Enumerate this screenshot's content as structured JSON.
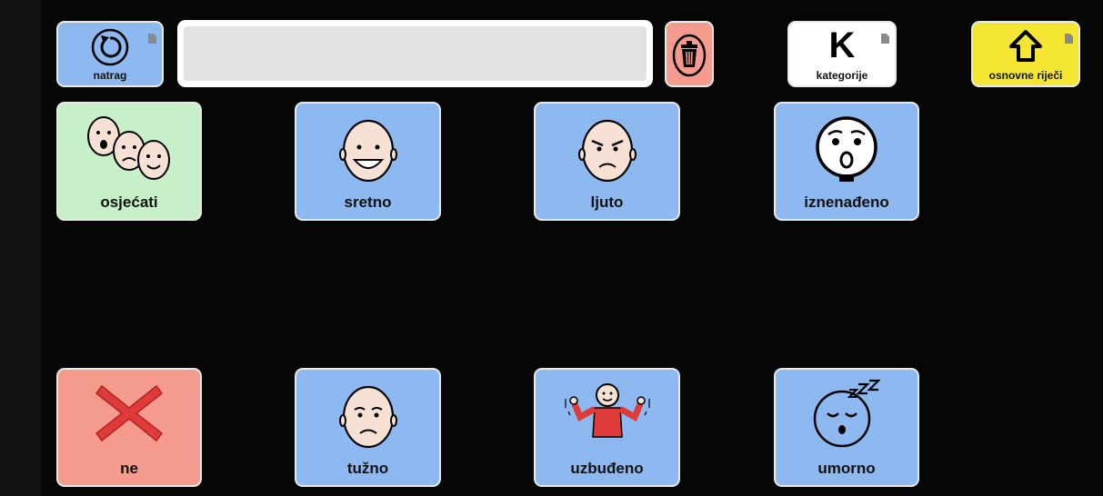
{
  "toolbar": {
    "back": {
      "label": "natrag",
      "icon": "back-arrow-icon"
    },
    "clear": {
      "icon": "trash-icon"
    },
    "categories": {
      "label": "kategorije",
      "letter": "K",
      "icon": "letter-k-icon"
    },
    "core_words": {
      "label": "osnovne riječi",
      "icon": "home-icon"
    },
    "sentence_text": ""
  },
  "tiles": [
    {
      "label": "osjećati",
      "icon": "feelings-faces-icon",
      "color": "#c8f0c8"
    },
    {
      "label": "sretno",
      "icon": "happy-face-icon",
      "color": "#8db8f0"
    },
    {
      "label": "ljuto",
      "icon": "angry-face-icon",
      "color": "#8db8f0"
    },
    {
      "label": "iznenađeno",
      "icon": "surprised-face-icon",
      "color": "#8db8f0"
    },
    {
      "label": "ne",
      "icon": "red-x-icon",
      "color": "#f49b8e"
    },
    {
      "label": "tužno",
      "icon": "sad-face-icon",
      "color": "#8db8f0"
    },
    {
      "label": "uzbuđeno",
      "icon": "excited-person-icon",
      "color": "#8db8f0"
    },
    {
      "label": "umorno",
      "icon": "sleepy-face-icon",
      "color": "#8db8f0"
    }
  ]
}
